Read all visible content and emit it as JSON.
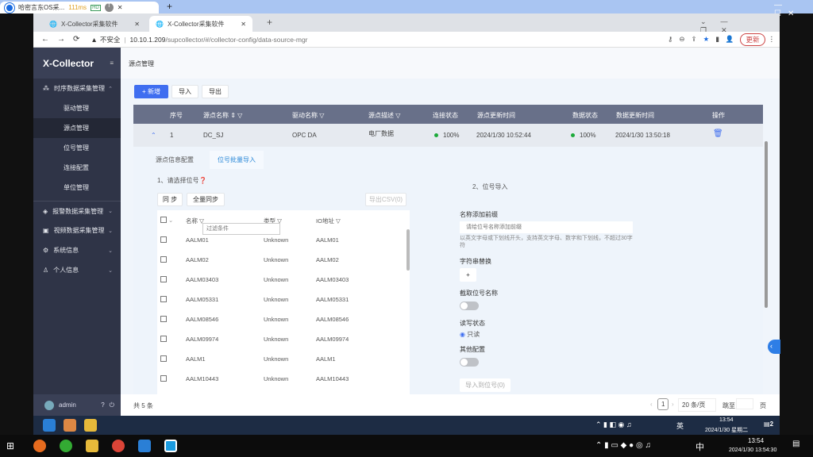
{
  "outer": {
    "tab_title": "哈密言东OS采...",
    "ping": "111ms",
    "hd_badge": "HD",
    "t_badge": "T"
  },
  "browser": {
    "tabs": [
      {
        "title": "X-Collector采集软件"
      },
      {
        "title": "X-Collector采集软件"
      }
    ],
    "insecure_label": "不安全",
    "url_host": "10.10.1.209",
    "url_path": "/supcollector/#/collector-config/data-source-mgr",
    "update_label": "更新"
  },
  "sidebar": {
    "logo": "X-Collector",
    "groups": [
      {
        "label": "时序数据采集管理",
        "expanded": true,
        "items": [
          "驱动管理",
          "源点管理",
          "位号管理",
          "连接配置",
          "单位管理"
        ],
        "selected": "源点管理"
      },
      {
        "label": "报警数据采集管理"
      },
      {
        "label": "视频数据采集管理"
      },
      {
        "label": "系统信息"
      },
      {
        "label": "个人信息"
      }
    ],
    "user": "admin"
  },
  "main": {
    "breadcrumb": "源点管理",
    "toolbar": {
      "add": "+ 新增",
      "import": "导入",
      "export": "导出"
    },
    "table": {
      "headers": [
        "序号",
        "源点名称",
        "驱动名称",
        "源点描述",
        "连接状态",
        "源点更新时间",
        "数据状态",
        "数据更新时间",
        "操作"
      ],
      "rows": [
        {
          "index": "1",
          "name": "DC_SJ",
          "driver": "OPC DA",
          "desc": "电厂数据",
          "conn": "100%",
          "src_time": "2024/1/30 10:52:44",
          "data_status": "100%",
          "data_time": "2024/1/30 13:50:18"
        }
      ]
    },
    "detail": {
      "tabs": [
        "源点信息配置",
        "位号批量导入"
      ],
      "active_tab": "位号批量导入",
      "step1": "1、请选择位号",
      "sync": "同 步",
      "full_sync": "全量同步",
      "export_csv": "导出CSV(0)",
      "list_headers": [
        "名称",
        "类型",
        "IO地址"
      ],
      "filter_placeholder": "过滤条件",
      "items": [
        [
          "AALM01",
          "Unknown",
          "AALM01"
        ],
        [
          "AALM02",
          "Unknown",
          "AALM02"
        ],
        [
          "AALM03403",
          "Unknown",
          "AALM03403"
        ],
        [
          "AALM05331",
          "Unknown",
          "AALM05331"
        ],
        [
          "AALM08546",
          "Unknown",
          "AALM08546"
        ],
        [
          "AALM09974",
          "Unknown",
          "AALM09974"
        ],
        [
          "AALM1",
          "Unknown",
          "AALM1"
        ],
        [
          "AALM10443",
          "Unknown",
          "AALM10443"
        ]
      ],
      "step2": "2、位号导入",
      "prefix_label": "名称添加前缀",
      "prefix_placeholder": "请给位号名称添加前缀",
      "prefix_hint": "以英文字母或下划线开头，支持英文字母、数字和下划线，不超过30字符",
      "replace_label": "字符串替换",
      "replace_add": "+",
      "truncate_label": "截取位号名称",
      "truncate_on": false,
      "rw_label": "读写状态",
      "rw_option": "只读",
      "other_label": "其他配置",
      "other_on": false,
      "import_btn": "导入到位号(0)"
    },
    "footer": {
      "total": "共 5 条",
      "page": "1",
      "page_size": "20 条/页",
      "goto": "跳至",
      "page_unit": "页"
    }
  },
  "inner_taskbar": {
    "time": "13:54",
    "date": "2024/1/30 星期二",
    "ime": "英",
    "notif": "2"
  },
  "outer_taskbar": {
    "time": "13:54",
    "date": "2024/1/30 13:54:30",
    "ime": "中"
  },
  "colors": {
    "primary": "#3f6ef0",
    "sidebar": "#2f3447",
    "header": "#687089",
    "ok": "#1caa3a"
  }
}
